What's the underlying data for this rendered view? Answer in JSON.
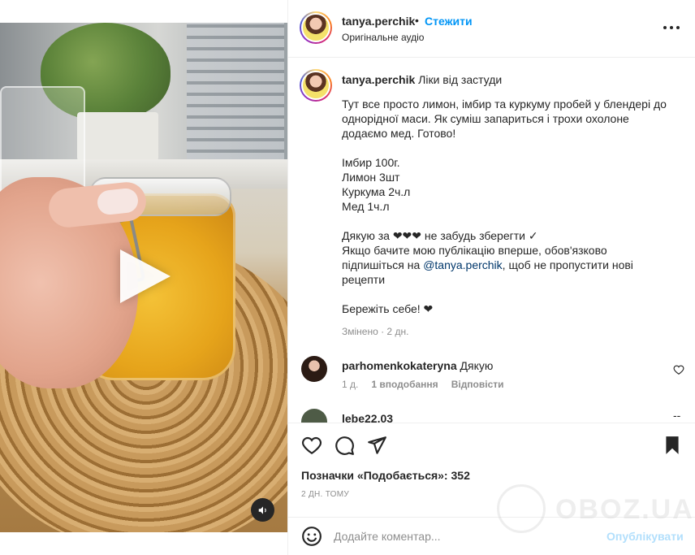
{
  "header": {
    "username": "tanya.perchik",
    "dot": "•",
    "follow_label": "Стежити",
    "audio_label": "Оригінальне аудіо",
    "more_icon": "more-horizontal-icon"
  },
  "caption": {
    "username": "tanya.perchik",
    "title": "Ліки від застуди",
    "p1_l1": "Тут все просто лимон, імбир та куркуму пробей у блендері до",
    "p1_l2": "однорідної маси. Як суміш запариться і трохи охолоне",
    "p1_l3": "додаємо мед. Готово!",
    "ing1": "Імбир 100г.",
    "ing2": "Лимон 3шт",
    "ing3": "Куркума 2ч.л",
    "ing4": "Мед 1ч.л",
    "p3_l1": "Дякую за ❤❤❤ не забудь зберегти ✓",
    "p3_l2": "Якщо бачите мою публікацію вперше, обов'язково",
    "p3_l3_a": "підпишіться на ",
    "mention": "@tanya.perchik",
    "p3_l3_b": ", щоб не пропустити нові",
    "p3_l4": "рецепти",
    "p4": "Бережіть себе! ❤",
    "edited": "Змінено · 2 дн."
  },
  "comments": [
    {
      "username": "parhomenkokateryna",
      "text": "Дякую",
      "age": "1 д.",
      "likes": "1 вподобання",
      "reply_label": "Відповісти"
    },
    {
      "username": "lebe22.03",
      "more": "--"
    }
  ],
  "actions": {
    "likes_label": "Позначки «Подобається»:",
    "likes_count": "352",
    "time_label": "2 ДН. ТОМУ"
  },
  "compose": {
    "placeholder": "Додайте коментар...",
    "publish_label": "Опублікувати"
  },
  "watermark": {
    "text": "OBOZ.UA"
  },
  "colors": {
    "link": "#0095f6",
    "publish_disabled": "#b2dffc",
    "mention": "#00376b",
    "muted": "#8e8e8e",
    "text": "#262626"
  }
}
